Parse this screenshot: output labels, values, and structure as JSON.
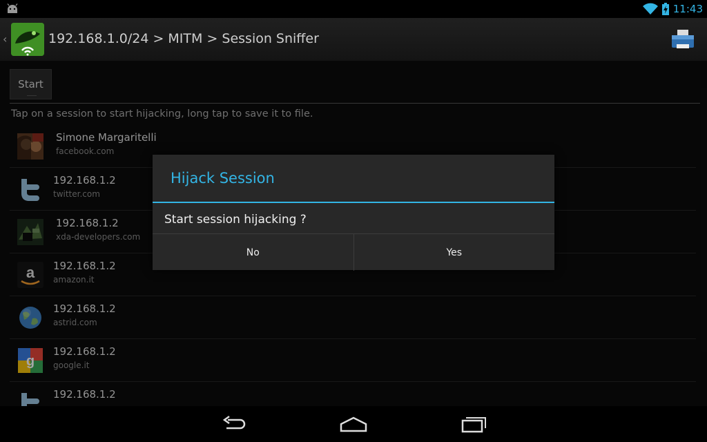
{
  "status_bar": {
    "time": "11:43",
    "notification_icon": "android-icon",
    "wifi_icon": "wifi-icon",
    "battery_icon": "battery-charging-icon"
  },
  "action_bar": {
    "up_icon": "chevron-left-icon",
    "app_icon": "dsploit-logo",
    "title": "192.168.1.0/24 > MITM > Session Sniffer",
    "action_icon": "printer-icon"
  },
  "main": {
    "start_button_label": "Start",
    "hint": "Tap on a session to start hijacking, long tap to save it to file.",
    "sessions": [
      {
        "title": "Simone Margaritelli",
        "subtitle": "facebook.com",
        "icon": "user-photo"
      },
      {
        "title": "192.168.1.2",
        "subtitle": "twitter.com",
        "icon": "twitter-icon"
      },
      {
        "title": "192.168.1.2",
        "subtitle": "xda-developers.com",
        "icon": "xda-icon"
      },
      {
        "title": "192.168.1.2",
        "subtitle": "amazon.it",
        "icon": "amazon-icon"
      },
      {
        "title": "192.168.1.2",
        "subtitle": "astrid.com",
        "icon": "globe-icon"
      },
      {
        "title": "192.168.1.2",
        "subtitle": "google.it",
        "icon": "google-icon"
      },
      {
        "title": "192.168.1.2",
        "subtitle": "",
        "icon": "twitter-icon"
      }
    ]
  },
  "dialog": {
    "title": "Hijack Session",
    "message": "Start session hijacking ?",
    "negative_label": "No",
    "positive_label": "Yes",
    "accent_color": "#33b5e5"
  },
  "nav_bar": {
    "back_icon": "back-icon",
    "home_icon": "home-icon",
    "recents_icon": "recents-icon"
  }
}
